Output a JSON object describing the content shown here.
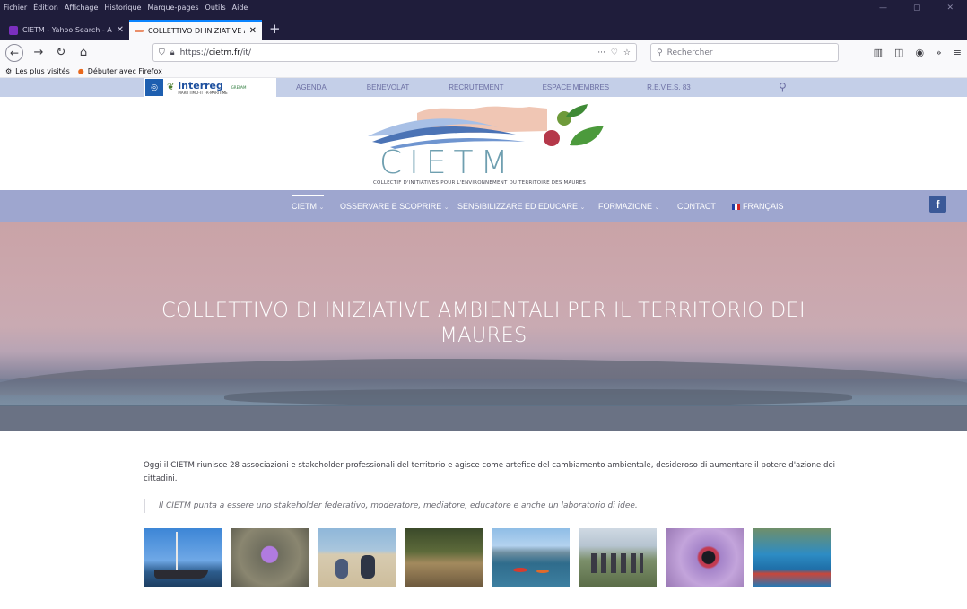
{
  "browser": {
    "menu": [
      "Fichier",
      "Édition",
      "Affichage",
      "Historique",
      "Marque-pages",
      "Outils",
      "Aide"
    ],
    "tabs": [
      {
        "title": "CIETM - Yahoo Search - Actuali",
        "favicon_color": "#7b2fbf"
      },
      {
        "title": "COLLETTIVO DI INIZIATIVE AMB",
        "favicon_color": "#ea8f6a"
      }
    ],
    "url_prefix": "https://",
    "url_domain": "cietm.fr",
    "url_path": "/it/",
    "search_placeholder": "Rechercher",
    "bookmarks": [
      "Les plus visités",
      "Débuter avec Firefox"
    ]
  },
  "site": {
    "logo_text": "interreg",
    "logo_sub": "MARITTIMO-IT FR-MARITIME",
    "logo_sub2": "GREPAM",
    "top_nav": [
      "AGENDA",
      "BENEVOLAT",
      "RECRUTEMENT",
      "ESPACE MEMBRES",
      "R.E.V.E.S. 83"
    ],
    "wordmark": "CIETM",
    "tagline": "COLLECTIF D'INITIATIVES POUR L'ENVIRONNEMENT DU TERRITOIRE DES MAURES",
    "main_nav": {
      "cietm": "CIETM",
      "osservare": "OSSERVARE E SCOPRIRE",
      "sensibilizzare": "SENSIBILIZZARE ED EDUCARE",
      "formazione": "FORMAZIONE",
      "contact": "CONTACT",
      "francais": "FRANÇAIS"
    },
    "facebook": "f",
    "hero_title": "COLLETTIVO DI INIZIATIVE AMBIENTALI PER IL TERRITORIO DEI MAURES",
    "intro": "Oggi il CIETM riunisce 28 associazioni e stakeholder professionali del territorio e agisce come artefice del cambiamento ambientale, desideroso di aumentare il potere d'azione dei cittadini.",
    "quote": "Il CIETM punta a essere uno stakeholder federativo, moderatore, mediatore, educatore e anche un laboratorio di idee.",
    "gallery": [
      {
        "name": "sailing-boat"
      },
      {
        "name": "purple-crocus"
      },
      {
        "name": "beach-group"
      },
      {
        "name": "garden-planter"
      },
      {
        "name": "kayaks-lake"
      },
      {
        "name": "hikers-group"
      },
      {
        "name": "moth-on-flower"
      },
      {
        "name": "fishing-boats"
      }
    ]
  },
  "colors": {
    "nav_bar": "#9ea6cf",
    "top_strip": "#c4cfe8",
    "accent": "#0a84ff"
  }
}
